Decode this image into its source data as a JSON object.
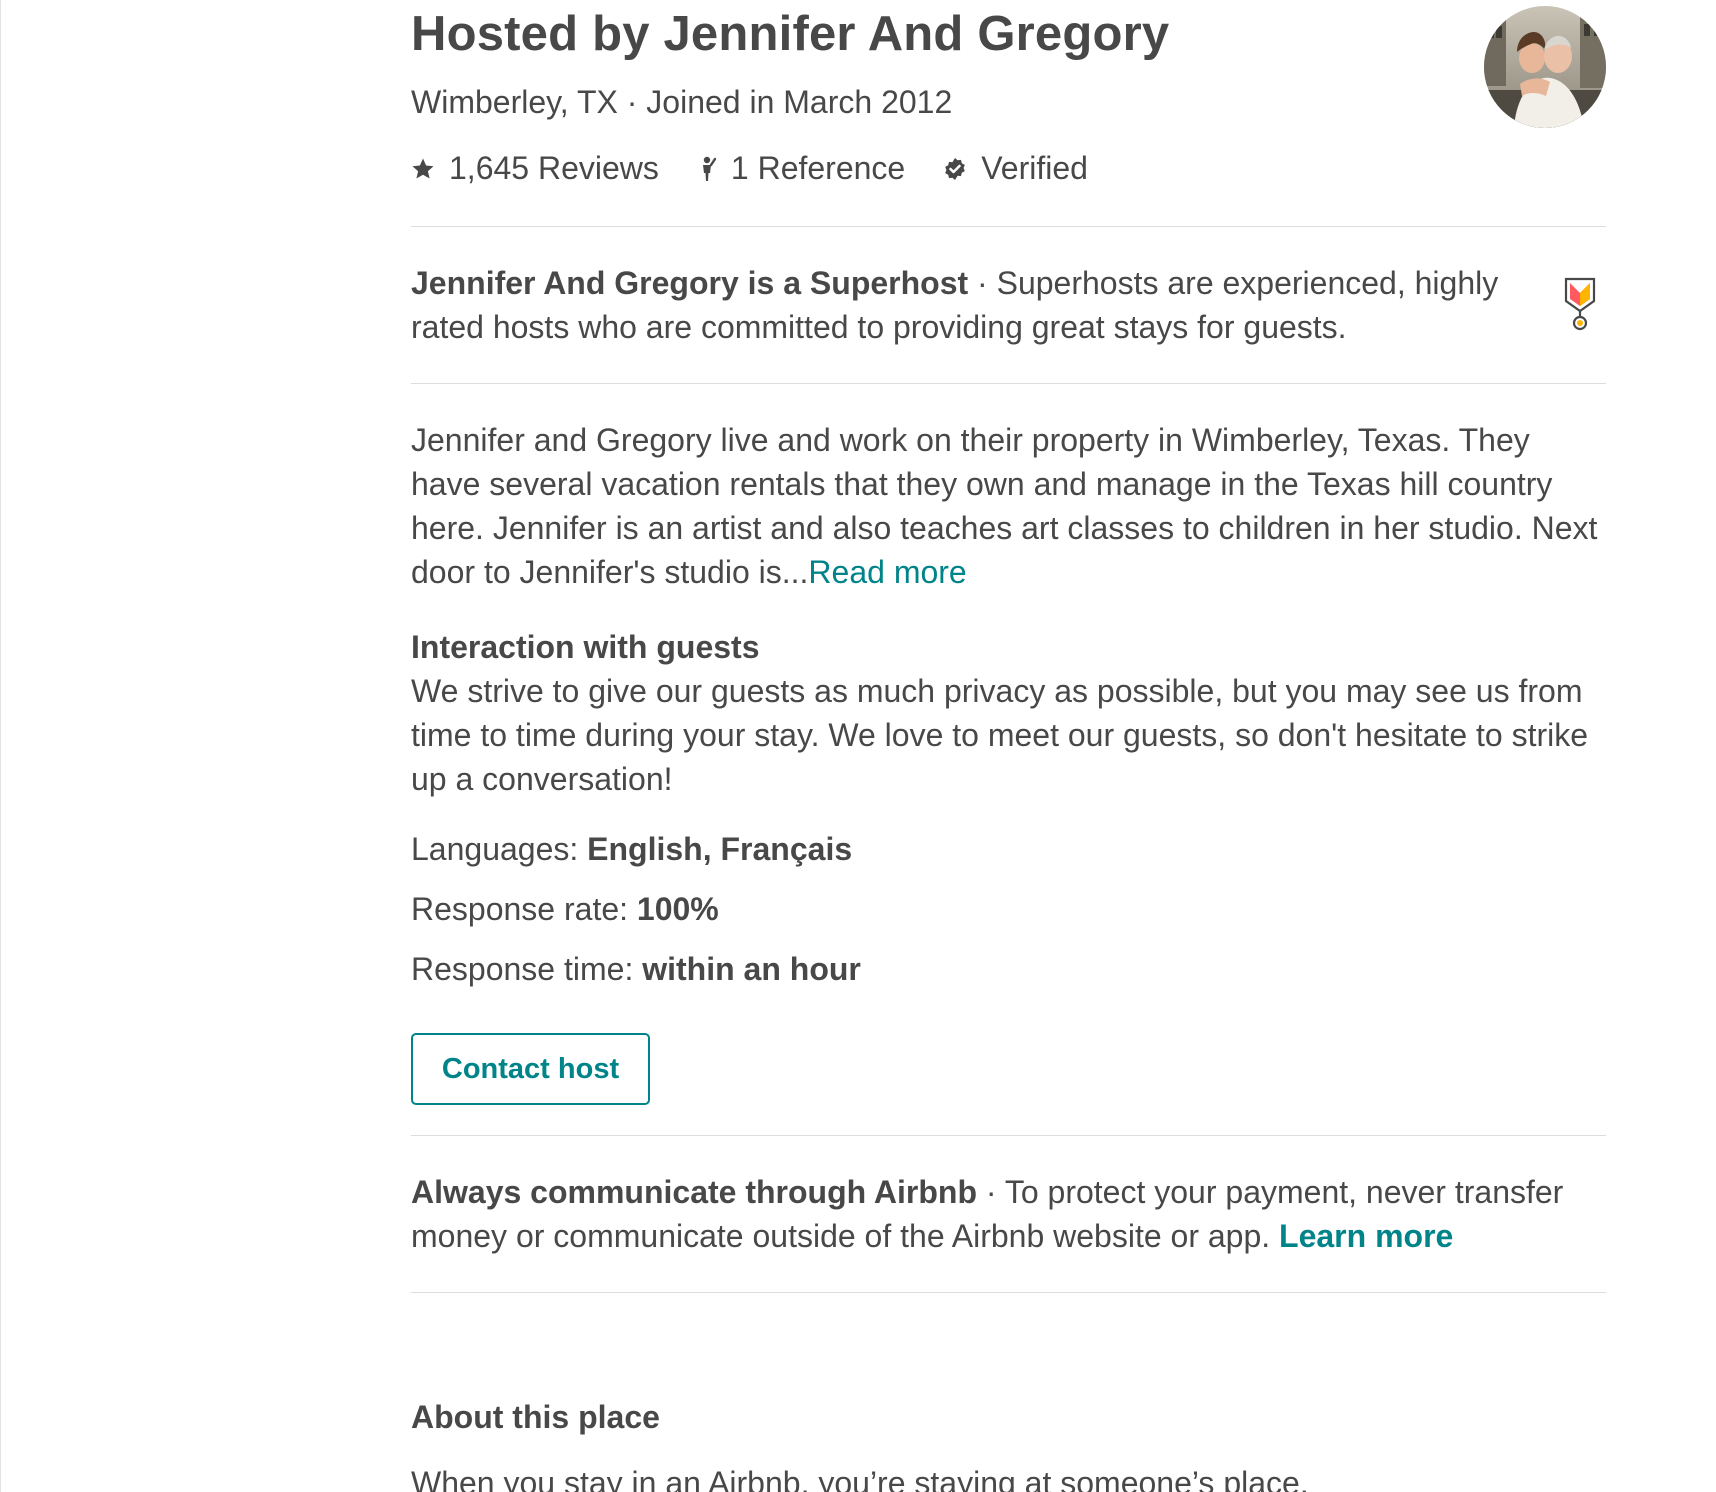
{
  "host": {
    "title": "Hosted by Jennifer And Gregory",
    "subtitle": "Wimberley, TX · Joined in March 2012",
    "stats": {
      "reviews": "1,645 Reviews",
      "references": "1 Reference",
      "verified": "Verified"
    },
    "avatar_icon": "host-photo"
  },
  "superhost": {
    "name": "Jennifer And Gregory is a Superhost",
    "separator": " · ",
    "description": "Superhosts are experienced, highly rated hosts who are committed to providing great stays for guests.",
    "icon": "superhost-medal-icon"
  },
  "bio": {
    "text": "Jennifer and Gregory live and work on their property in Wimberley, Texas. They have several vacation rentals that they own and manage in the Texas hill country here. Jennifer is an artist and also teaches art classes to children in her studio. Next door to Jennifer's studio is...",
    "read_more": "Read more"
  },
  "interaction": {
    "heading": "Interaction with guests",
    "text": "We strive to give our guests as much privacy as possible, but you may see us from time to time during your stay. We love to meet our guests, so don't hesitate to strike up a conversation!"
  },
  "facts": {
    "languages_label": "Languages: ",
    "languages_value": "English, Français",
    "response_rate_label": "Response rate: ",
    "response_rate_value": "100%",
    "response_time_label": "Response time: ",
    "response_time_value": "within an hour"
  },
  "contact_button": "Contact host",
  "notice": {
    "title": "Always communicate through Airbnb",
    "separator": " · ",
    "text": "To protect your payment, never transfer money or communicate outside of the Airbnb website or app. ",
    "learn_more": "Learn more"
  },
  "about": {
    "heading": "About this place",
    "text": "When you stay in an Airbnb, you’re staying at someone’s place."
  },
  "colors": {
    "text": "#484848",
    "accent": "#008489",
    "divider": "#dddddd"
  }
}
